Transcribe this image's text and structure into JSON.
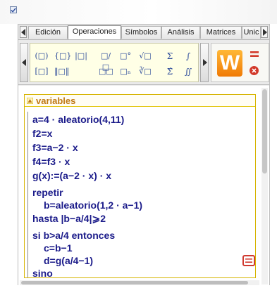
{
  "tabs": {
    "items": [
      {
        "label": "Edición"
      },
      {
        "label": "Operaciones"
      },
      {
        "label": "Símbolos"
      },
      {
        "label": "Análisis"
      },
      {
        "label": "Matrices"
      },
      {
        "label": "Unic"
      }
    ],
    "active": "Operaciones"
  },
  "palette": {
    "row1": [
      "(□)",
      "{□}",
      "|□|",
      "□/□",
      "□°",
      "√□",
      "Σ",
      "∫"
    ],
    "row2": [
      "[□]",
      "‖□‖",
      "□□",
      "□ₙ",
      "∛□",
      "Σ̂",
      "∬"
    ]
  },
  "logo": {
    "letter": "W"
  },
  "document": {
    "block_title": "variables",
    "lines": [
      {
        "text": "a=4 · aleatorio(4,11)"
      },
      {
        "text": "f2=x"
      },
      {
        "text": "f3=a−2 · x"
      },
      {
        "text": "f4=f3 · x"
      },
      {
        "text": "g(x):=(a−2 · x) · x"
      },
      {
        "text": "repetir"
      },
      {
        "text": "b=aleatorio(1,2 · a−1)"
      },
      {
        "text": "hasta |b−a/4|⩾2"
      },
      {
        "text": "si b>a/4 entonces"
      },
      {
        "text": "c=b−1"
      },
      {
        "text": "d=g(a/4−1)"
      },
      {
        "text": "sino"
      }
    ]
  },
  "colors": {
    "accent_orange": "#f07b05",
    "block_border": "#d6b400",
    "block_title": "#c07a15",
    "code_text": "#1b1b8a",
    "close_red": "#d23a2b"
  }
}
